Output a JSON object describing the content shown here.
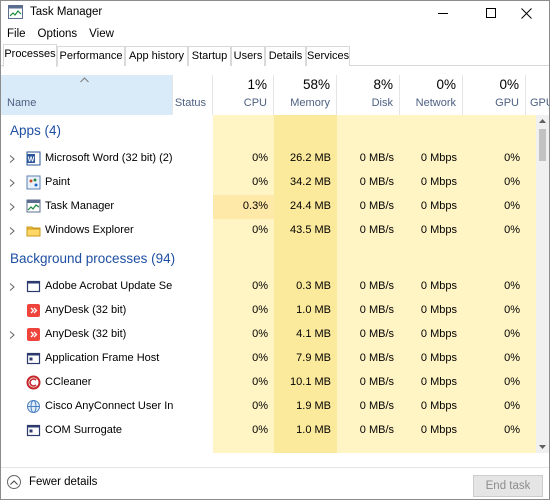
{
  "window": {
    "title": "Task Manager",
    "controls": [
      "minimize",
      "maximize",
      "close"
    ]
  },
  "menu": [
    "File",
    "Options",
    "View"
  ],
  "tabs": [
    {
      "label": "Processes",
      "active": true
    },
    {
      "label": "Performance"
    },
    {
      "label": "App history"
    },
    {
      "label": "Startup"
    },
    {
      "label": "Users"
    },
    {
      "label": "Details"
    },
    {
      "label": "Services"
    }
  ],
  "columns": {
    "name": "Name",
    "status": "Status",
    "cpu": {
      "label": "CPU",
      "pct": "1%"
    },
    "memory": {
      "label": "Memory",
      "pct": "58%"
    },
    "disk": {
      "label": "Disk",
      "pct": "8%"
    },
    "network": {
      "label": "Network",
      "pct": "0%"
    },
    "gpu": {
      "label": "GPU",
      "pct": "0%"
    },
    "gpu_engine": "GPU"
  },
  "groups": [
    {
      "title": "Apps (4)",
      "rows": [
        {
          "name": "Microsoft Word (32 bit) (2)",
          "icon": "word-icon",
          "expandable": true,
          "cpu": "0%",
          "memory": "26.2 MB",
          "disk": "0 MB/s",
          "network": "0 Mbps",
          "gpu": "0%"
        },
        {
          "name": "Paint",
          "icon": "paint-icon",
          "expandable": true,
          "cpu": "0%",
          "memory": "34.2 MB",
          "disk": "0 MB/s",
          "network": "0 Mbps",
          "gpu": "0%"
        },
        {
          "name": "Task Manager",
          "icon": "task-manager-icon",
          "expandable": true,
          "cpu": "0.3%",
          "memory": "24.4 MB",
          "disk": "0 MB/s",
          "network": "0 Mbps",
          "gpu": "0%"
        },
        {
          "name": "Windows Explorer",
          "icon": "folder-icon",
          "expandable": true,
          "cpu": "0%",
          "memory": "43.5 MB",
          "disk": "0 MB/s",
          "network": "0 Mbps",
          "gpu": "0%"
        }
      ]
    },
    {
      "title": "Background processes (94)",
      "rows": [
        {
          "name": "Adobe Acrobat Update Se...",
          "icon": "window-icon",
          "expandable": true,
          "cpu": "0%",
          "memory": "0.3 MB",
          "disk": "0 MB/s",
          "network": "0 Mbps",
          "gpu": "0%"
        },
        {
          "name": "AnyDesk (32 bit)",
          "icon": "anydesk-icon",
          "expandable": false,
          "cpu": "0%",
          "memory": "1.0 MB",
          "disk": "0 MB/s",
          "network": "0 Mbps",
          "gpu": "0%"
        },
        {
          "name": "AnyDesk (32 bit)",
          "icon": "anydesk-icon",
          "expandable": true,
          "cpu": "0%",
          "memory": "4.1 MB",
          "disk": "0 MB/s",
          "network": "0 Mbps",
          "gpu": "0%"
        },
        {
          "name": "Application Frame Host",
          "icon": "app-frame-icon",
          "expandable": false,
          "cpu": "0%",
          "memory": "7.9 MB",
          "disk": "0 MB/s",
          "network": "0 Mbps",
          "gpu": "0%"
        },
        {
          "name": "CCleaner",
          "icon": "ccleaner-icon",
          "expandable": false,
          "cpu": "0%",
          "memory": "10.1 MB",
          "disk": "0 MB/s",
          "network": "0 Mbps",
          "gpu": "0%"
        },
        {
          "name": "Cisco AnyConnect User In...",
          "icon": "globe-icon",
          "expandable": false,
          "cpu": "0%",
          "memory": "1.9 MB",
          "disk": "0 MB/s",
          "network": "0 Mbps",
          "gpu": "0%"
        },
        {
          "name": "COM Surrogate",
          "icon": "app-frame-icon",
          "expandable": false,
          "cpu": "0%",
          "memory": "1.0 MB",
          "disk": "0 MB/s",
          "network": "0 Mbps",
          "gpu": "0%"
        }
      ]
    }
  ],
  "footer": {
    "fewer_details": "Fewer details",
    "end_task": "End task"
  },
  "colors": {
    "heat_light": "#fff4c4",
    "heat_mid": "#ffeab3",
    "heat_mem": "#fcea9c",
    "group_title": "#1e4fa3",
    "header_label": "#4d6082"
  }
}
